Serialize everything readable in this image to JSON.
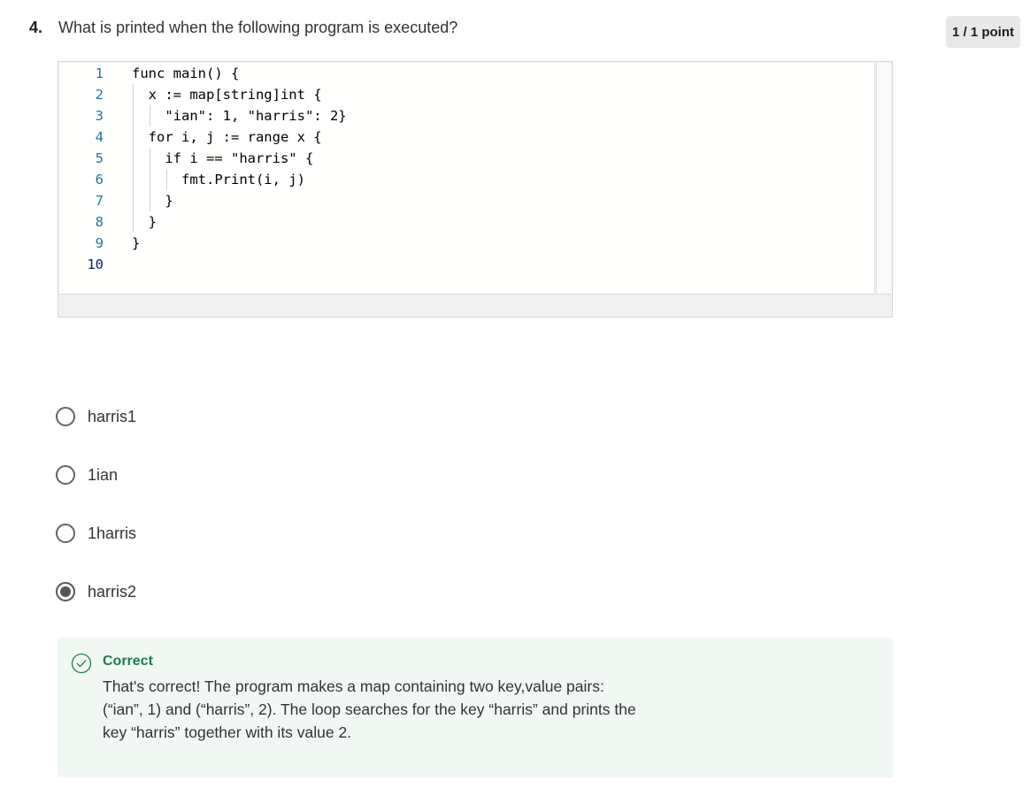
{
  "question": {
    "number": "4.",
    "text": "What is printed when the following program is executed?",
    "points": "1 / 1 point"
  },
  "code": {
    "lines": [
      {
        "num": "1",
        "text": "func main() {"
      },
      {
        "num": "2",
        "text": "  x := map[string]int {"
      },
      {
        "num": "3",
        "text": "    \"ian\": 1, \"harris\": 2}"
      },
      {
        "num": "4",
        "text": "  for i, j := range x {"
      },
      {
        "num": "5",
        "text": "    if i == \"harris\" {"
      },
      {
        "num": "6",
        "text": "      fmt.Print(i, j)"
      },
      {
        "num": "7",
        "text": "    }"
      },
      {
        "num": "8",
        "text": "  }"
      },
      {
        "num": "9",
        "text": "}"
      },
      {
        "num": "10",
        "text": ""
      }
    ]
  },
  "options": [
    {
      "label": "harris1",
      "selected": false
    },
    {
      "label": "1ian",
      "selected": false
    },
    {
      "label": "1harris",
      "selected": false
    },
    {
      "label": "harris2",
      "selected": true
    }
  ],
  "feedback": {
    "status": "Correct",
    "icon": "check-circle-icon",
    "text": "That's correct! The program makes a map containing two key,value pairs: (“ian”, 1) and (“harris”, 2). The loop searches for the key “harris” and prints the key “harris” together with its value 2."
  },
  "colors": {
    "correct_green": "#1d7c50",
    "feedback_bg": "#f1f8f4",
    "line_number": "#237893",
    "active_line_number": "#0b216f"
  }
}
